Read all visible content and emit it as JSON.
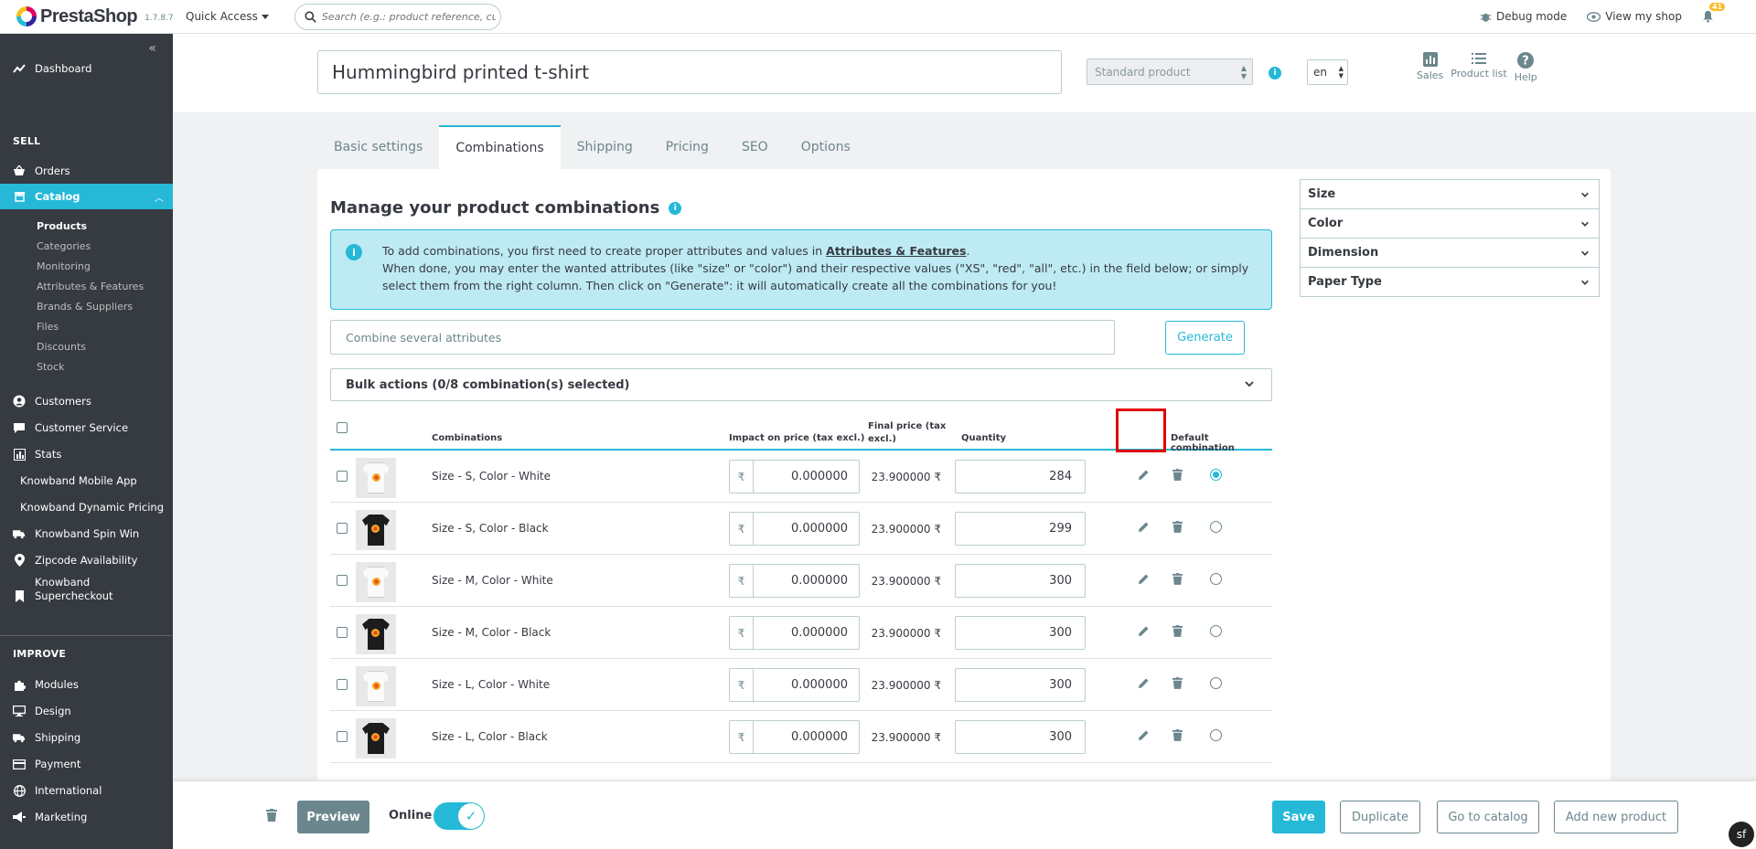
{
  "header": {
    "logo_text": "PrestaShop",
    "version": "1.7.8.7",
    "quick_access": "Quick Access",
    "search_placeholder": "Search (e.g.: product reference, custon",
    "debug_mode": "Debug mode",
    "view_shop": "View my shop",
    "notifications_count": "41"
  },
  "sidebar": {
    "dashboard": "Dashboard",
    "sell_title": "SELL",
    "orders": "Orders",
    "catalog": "Catalog",
    "catalog_sub": [
      "Products",
      "Categories",
      "Monitoring",
      "Attributes & Features",
      "Brands & Suppliers",
      "Files",
      "Discounts",
      "Stock"
    ],
    "customers": "Customers",
    "customer_service": "Customer Service",
    "stats": "Stats",
    "knowband_mobile": "Knowband Mobile App",
    "knowband_dynamic": "Knowband Dynamic Pricing",
    "knowband_spin": "Knowband Spin Win",
    "zipcode": "Zipcode Availability",
    "knowband_super_1": "Knowband",
    "knowband_super_2": "Supercheckout",
    "improve_title": "IMPROVE",
    "modules": "Modules",
    "design": "Design",
    "shipping": "Shipping",
    "payment": "Payment",
    "international": "International",
    "marketing": "Marketing"
  },
  "product": {
    "name": "Hummingbird printed t-shirt",
    "type": "Standard product",
    "lang": "en"
  },
  "quick_icons": {
    "sales": "Sales",
    "product_list": "Product list",
    "help": "Help"
  },
  "tabs": [
    "Basic settings",
    "Combinations",
    "Shipping",
    "Pricing",
    "SEO",
    "Options"
  ],
  "combinations": {
    "title": "Manage your product combinations",
    "alert_line1_prefix": "To add combinations, you first need to create proper attributes and values in ",
    "alert_link": "Attributes & Features",
    "alert_line1_suffix": ".",
    "alert_line2": "When done, you may enter the wanted attributes (like \"size\" or \"color\") and their respective values (\"XS\", \"red\", \"all\", etc.) in the field below; or simply select them from the right column. Then click on \"Generate\": it will automatically create all the combinations for you!",
    "combine_placeholder": "Combine several attributes",
    "generate": "Generate",
    "bulk_actions": "Bulk actions (0/8 combination(s) selected)",
    "headers": {
      "combinations": "Combinations",
      "impact": "Impact on price (tax excl.)",
      "final_1": "Final price (tax",
      "final_2": "excl.)",
      "quantity": "Quantity",
      "default": "Default combination"
    },
    "currency": "₹",
    "rows": [
      {
        "name": "Size - S, Color - White",
        "impact": "0.000000",
        "final": "23.900000 ₹",
        "qty": "284",
        "color": "white",
        "default": true
      },
      {
        "name": "Size - S, Color - Black",
        "impact": "0.000000",
        "final": "23.900000 ₹",
        "qty": "299",
        "color": "black",
        "default": false
      },
      {
        "name": "Size - M, Color - White",
        "impact": "0.000000",
        "final": "23.900000 ₹",
        "qty": "300",
        "color": "white",
        "default": false
      },
      {
        "name": "Size - M, Color - Black",
        "impact": "0.000000",
        "final": "23.900000 ₹",
        "qty": "300",
        "color": "black",
        "default": false
      },
      {
        "name": "Size - L, Color - White",
        "impact": "0.000000",
        "final": "23.900000 ₹",
        "qty": "300",
        "color": "white",
        "default": false
      },
      {
        "name": "Size - L, Color - Black",
        "impact": "0.000000",
        "final": "23.900000 ₹",
        "qty": "300",
        "color": "black",
        "default": false
      }
    ]
  },
  "attributes": [
    "Size",
    "Color",
    "Dimension",
    "Paper Type"
  ],
  "footer": {
    "preview": "Preview",
    "online": "Online",
    "save": "Save",
    "duplicate": "Duplicate",
    "go_catalog": "Go to catalog",
    "add_new": "Add new product"
  },
  "colors": {
    "accent": "#25b9d7",
    "sidebar": "#363a41",
    "highlight": "#e00000"
  }
}
